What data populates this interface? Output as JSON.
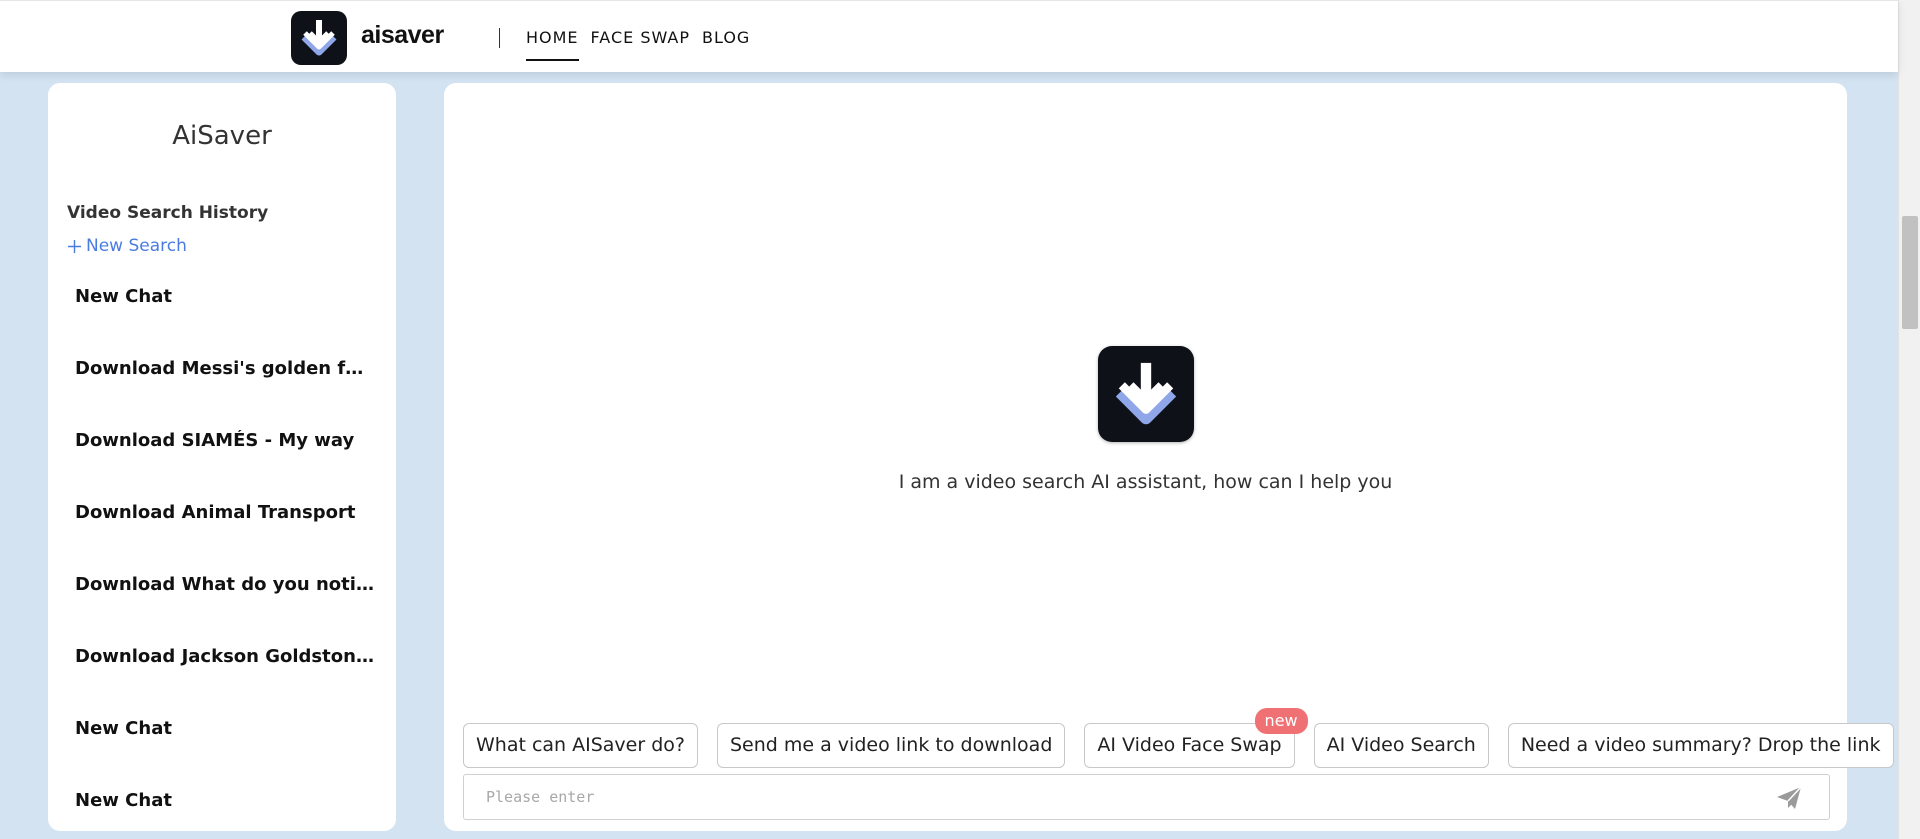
{
  "header": {
    "brand": "aisaver",
    "nav": [
      {
        "label": "HOME",
        "active": true
      },
      {
        "label": "FACE SWAP",
        "active": false
      },
      {
        "label": "BLOG",
        "active": false
      }
    ]
  },
  "sidebar": {
    "title": "AiSaver",
    "history_heading": "Video Search History",
    "new_search_label": "New Search",
    "items": [
      "New Chat",
      "Download Messi's golden foo...",
      "Download SIAMÉS - My way",
      "Download Animal Transport",
      "Download What do you notic...",
      "Download Jackson Goldstone...",
      "New Chat",
      "New Chat"
    ]
  },
  "main": {
    "greeting": "I am a video search AI assistant, how can I help you",
    "chips": [
      {
        "label": "What can AISaver do?"
      },
      {
        "label": "Send me a video link to download"
      },
      {
        "label": "AI Video Face Swap",
        "badge": "new"
      },
      {
        "label": "AI Video Search"
      },
      {
        "label": "Need a video summary? Drop the link"
      }
    ],
    "input_placeholder": "Please enter"
  },
  "colors": {
    "page_bg": "#d3e3f1",
    "accent_link": "#4a7ce0",
    "badge": "#f07174",
    "logo_bg": "#0f1118"
  },
  "icons": {
    "logo": "download-arrow-icon",
    "send": "send-plane-icon",
    "plus": "plus-icon"
  }
}
